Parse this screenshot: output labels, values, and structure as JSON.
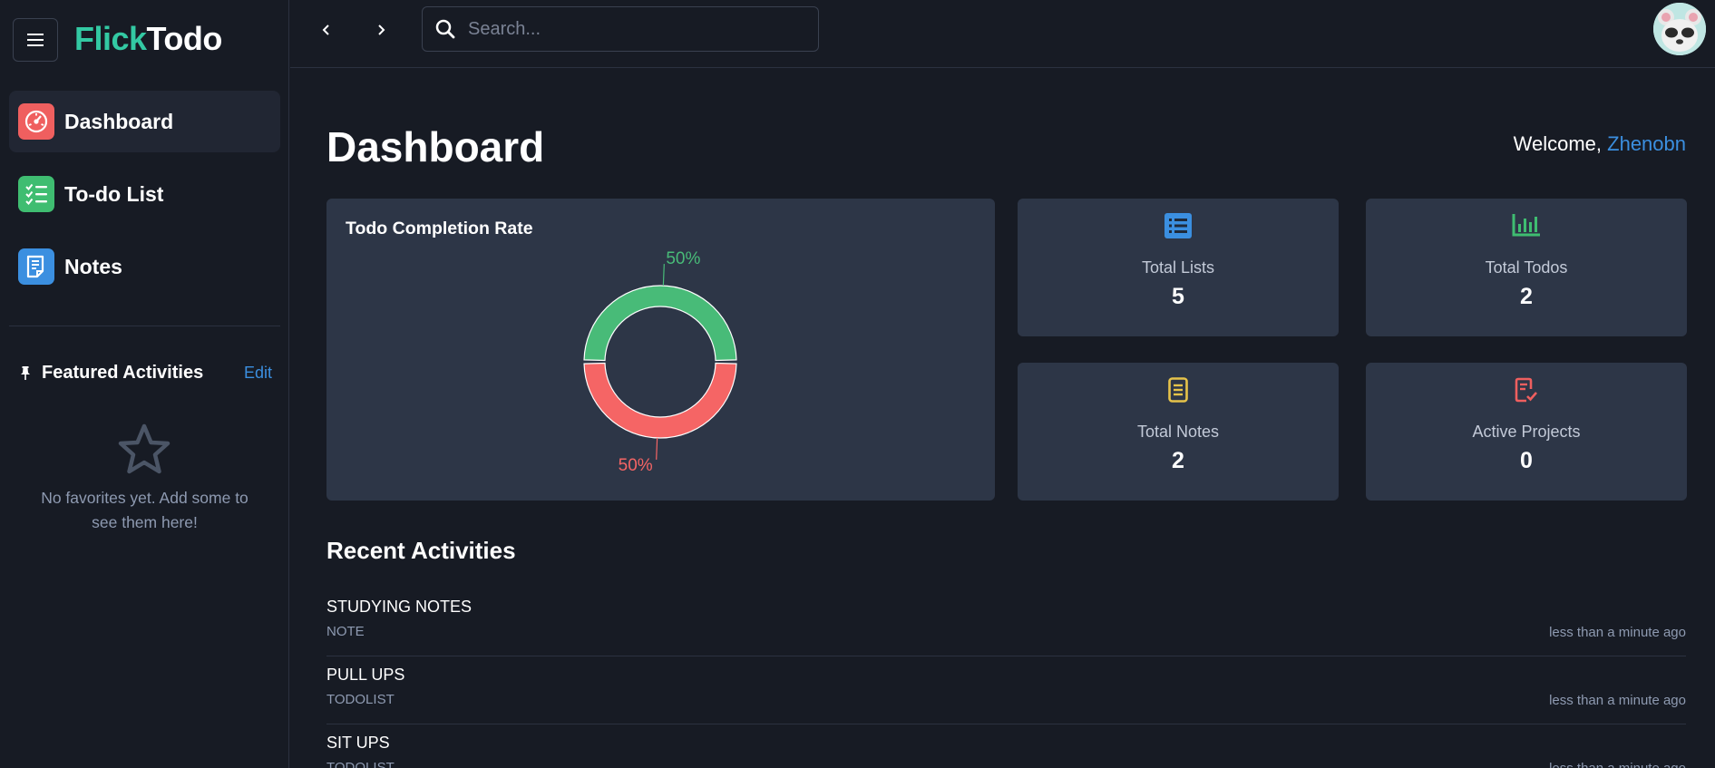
{
  "app": {
    "logo_part1": "Flick",
    "logo_part2": "Todo",
    "brand_color": "#33c9a3"
  },
  "sidebar": {
    "items": [
      {
        "label": "Dashboard",
        "icon": "dashboard-gauge-icon",
        "color": "#ef5f5f",
        "active": true
      },
      {
        "label": "To-do List",
        "icon": "checklist-icon",
        "color": "#3fbd71",
        "active": false
      },
      {
        "label": "Notes",
        "icon": "notes-icon",
        "color": "#3b8fe0",
        "active": false
      }
    ],
    "featured": {
      "title": "Featured Activities",
      "edit_label": "Edit",
      "empty_text": "No favorites yet. Add some to see them here!"
    }
  },
  "topbar": {
    "search_placeholder": "Search..."
  },
  "main": {
    "page_title": "Dashboard",
    "welcome_prefix": "Welcome,",
    "username": "Zhenobn"
  },
  "chart": {
    "title": "Todo Completion Rate"
  },
  "chart_data": {
    "type": "pie",
    "donut": true,
    "title": "Todo Completion Rate",
    "slices": [
      {
        "value": 50,
        "label": "50%",
        "color": "#48bb78"
      },
      {
        "value": 50,
        "label": "50%",
        "color": "#f56565"
      }
    ]
  },
  "stats": [
    {
      "label": "Total Lists",
      "value": "5",
      "icon": "list-icon",
      "color": "#3b8fe0"
    },
    {
      "label": "Total Todos",
      "value": "2",
      "icon": "bar-chart-icon",
      "color": "#3fbd71"
    },
    {
      "label": "Total Notes",
      "value": "2",
      "icon": "document-icon",
      "color": "#e6c34a"
    },
    {
      "label": "Active Projects",
      "value": "0",
      "icon": "task-check-icon",
      "color": "#ef5f5f"
    }
  ],
  "recent": {
    "title": "Recent Activities",
    "items": [
      {
        "name": "STUDYING NOTES",
        "type": "NOTE",
        "time": "less than a minute ago"
      },
      {
        "name": "PULL UPS",
        "type": "TODOLIST",
        "time": "less than a minute ago"
      },
      {
        "name": "SIT UPS",
        "type": "TODOLIST",
        "time": "less than a minute ago"
      }
    ]
  }
}
